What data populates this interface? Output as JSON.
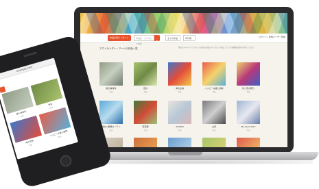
{
  "laptop": {
    "nav": {
      "primary_select": "作品を探す（タイトル）",
      "search_placeholder": "作品名・タグなどで検索",
      "select_2": "全ての作品",
      "select_3": "年代順",
      "right_link": "ログイン / 新規ユーザー登録"
    },
    "heading": "アウトサイダー・アートの作品一覧",
    "note": "作品のポーチングラッセンで作品をお楽しみください 作品についての詳細はお問い合わせください",
    "tiles": [
      {
        "caption": "紙の肖像作",
        "sub": "作品",
        "palette": [
          "#8f9c86",
          "#c7cfc0",
          "#6f7b72"
        ]
      },
      {
        "caption": "百鳥",
        "sub": "作品",
        "palette": [
          "#a9c36f",
          "#6f8a44",
          "#dbe7b4"
        ]
      },
      {
        "caption": "海の生物",
        "sub": "作品",
        "palette": [
          "#3e77c9",
          "#e44c3a",
          "#f2c94c"
        ]
      },
      {
        "caption": "ハッピーな猫と動物",
        "sub": "作品",
        "palette": [
          "#e85d4a",
          "#f5d36b",
          "#5bb0d8"
        ]
      },
      {
        "caption": "鳥と花の祭り",
        "sub": "作品",
        "palette": [
          "#f0d26a",
          "#b83a7a",
          "#3a5ec9"
        ]
      },
      {
        "caption": "暖かい部屋カーテン",
        "sub": "作品",
        "palette": [
          "#5ba9d6",
          "#b8dcef",
          "#2e6fa6"
        ]
      },
      {
        "caption": "東京駅",
        "sub": "作品",
        "palette": [
          "#3f7a3a",
          "#d24b36",
          "#9ac27a"
        ]
      },
      {
        "caption": "SUWAN",
        "sub": "作品",
        "palette": [
          "#e7e3dc",
          "#b7c8d6",
          "#d9b8b8"
        ]
      },
      {
        "caption": "山景",
        "sub": "作品",
        "palette": [
          "#7a7a7a",
          "#cfcfcf",
          "#4a4a4a"
        ]
      },
      {
        "caption": "My Land 2017",
        "sub": "作品",
        "palette": [
          "#9fb4d6",
          "#e7e9ef",
          "#6a7fa8"
        ]
      }
    ],
    "bottom_row": [
      {
        "palette": [
          "#d7d2c7",
          "#b8a88a"
        ]
      },
      {
        "palette": [
          "#cf6f3c",
          "#f0b15a"
        ]
      },
      {
        "palette": [
          "#6b9fd0",
          "#c9dff0"
        ]
      },
      {
        "palette": [
          "#a7c56a",
          "#e9d57a"
        ]
      },
      {
        "palette": [
          "#e05a4f",
          "#f6d96b"
        ]
      }
    ]
  },
  "phone": {
    "url": "example.com",
    "tiles": [
      {
        "caption": "紙の肖像作",
        "sub": "作品",
        "palette": [
          "#8f9c86",
          "#c7cfc0"
        ]
      },
      {
        "caption": "百鳥",
        "sub": "作品",
        "palette": [
          "#6f8a44",
          "#a9c36f"
        ]
      },
      {
        "caption": "海の生物",
        "sub": "作品",
        "palette": [
          "#3e77c9",
          "#e44c3a"
        ]
      },
      {
        "caption": "ハッピーな猫と動物",
        "sub": "作品",
        "palette": [
          "#e85d4a",
          "#5bb0d8"
        ]
      }
    ]
  },
  "colors": {
    "accent": "#e8542f",
    "device_dark": "#1f1f21",
    "page_bg": "#f6f3ec"
  }
}
